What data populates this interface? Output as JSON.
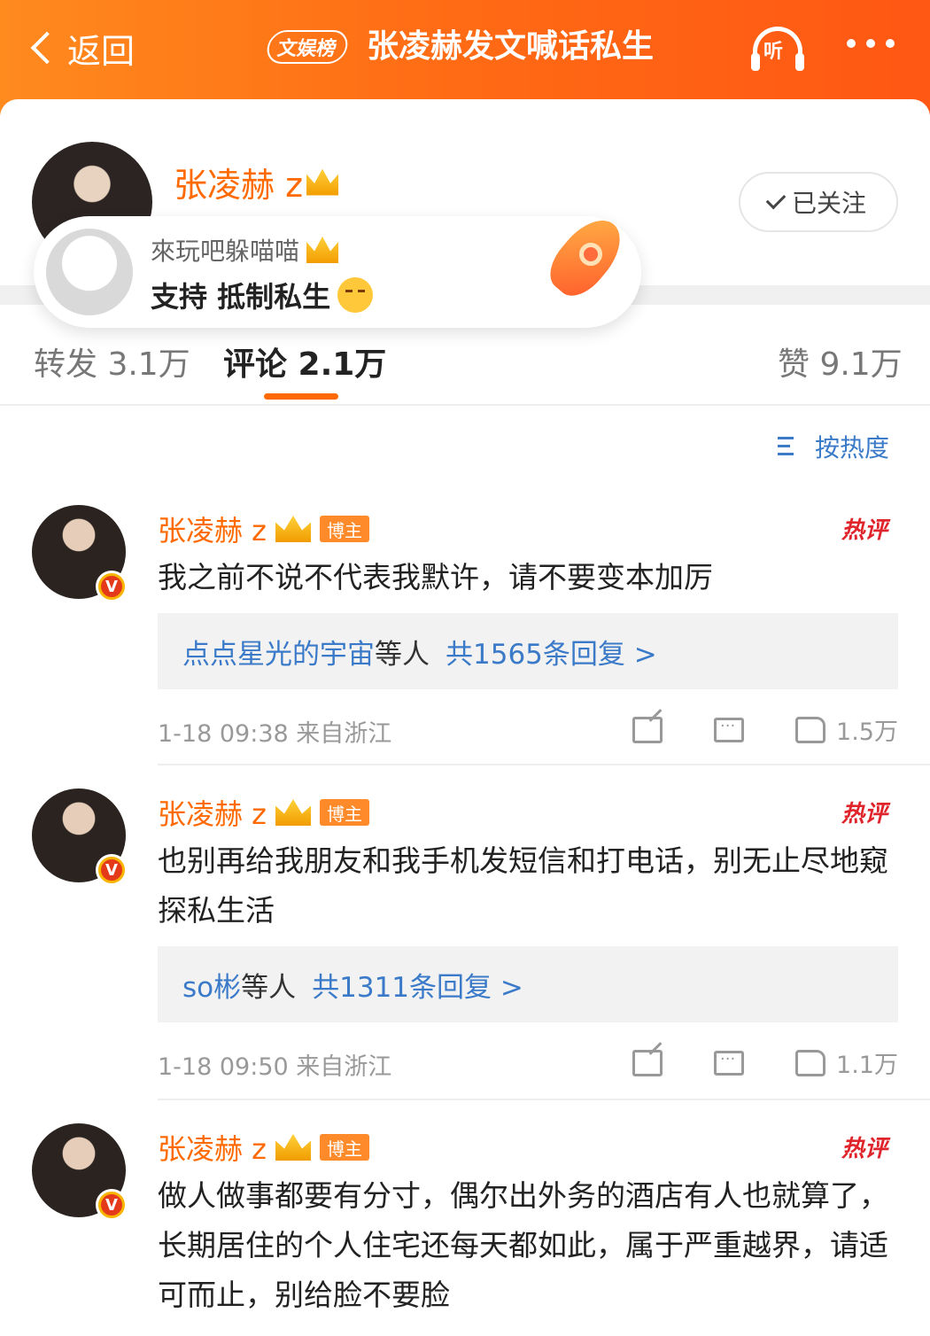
{
  "header": {
    "back_label": "返回",
    "rank_badge": "文娱榜",
    "title": "张凌赫发文喊话私生",
    "listen_label": "听"
  },
  "post": {
    "author_name": "张凌赫 z",
    "follow_label": "已关注",
    "bubble": {
      "user": "來玩吧躲喵喵",
      "text": "支持 抵制私生"
    }
  },
  "tabs": {
    "repost": "转发 3.1万",
    "comments": "评论 2.1万",
    "likes": "赞 9.1万"
  },
  "sort_label": "按热度",
  "comments": [
    {
      "name": "张凌赫 z",
      "tag": "博主",
      "hot": "热评",
      "text": "我之前不说不代表我默许，请不要变本加厉",
      "reply_users": "点点星光的宇宙",
      "reply_mid": "等人",
      "reply_count": "共1565条回复 >",
      "meta": "1-18 09:38  来自浙江",
      "likes": "1.5万"
    },
    {
      "name": "张凌赫 z",
      "tag": "博主",
      "hot": "热评",
      "text": "也别再给我朋友和我手机发短信和打电话，别无止尽地窥探私生活",
      "reply_users": "so彬",
      "reply_mid": "等人",
      "reply_count": "共1311条回复 >",
      "meta": "1-18 09:50  来自浙江",
      "likes": "1.1万"
    },
    {
      "name": "张凌赫 z",
      "tag": "博主",
      "hot": "热评",
      "text": "做人做事都要有分寸，偶尔出外务的酒店有人也就算了，长期居住的个人住宅还每天都如此，属于严重越界，请适可而止，别给脸不要脸"
    }
  ],
  "colors": {
    "accent": "#ff6a00",
    "link": "#3a7ac8",
    "hot": "#e0242b"
  }
}
